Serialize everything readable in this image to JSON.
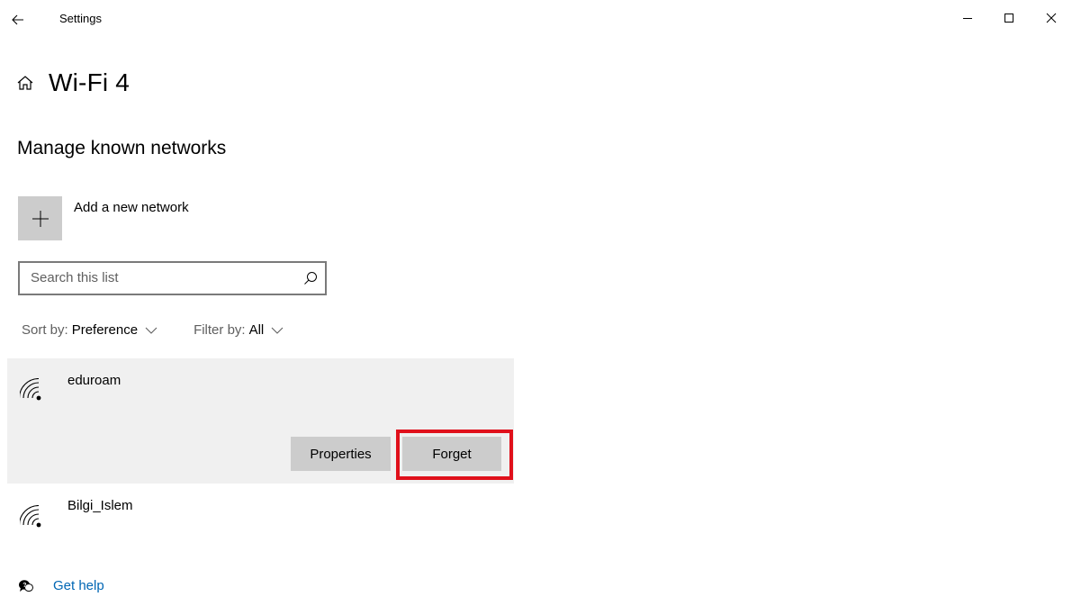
{
  "window": {
    "app_title": "Settings",
    "back_icon": "back-arrow-icon",
    "controls": [
      "minimize-icon",
      "maximize-icon",
      "close-icon"
    ]
  },
  "header": {
    "icon": "home-icon",
    "title": "Wi-Fi 4"
  },
  "section": {
    "title": "Manage known networks"
  },
  "add_network": {
    "icon": "plus-icon",
    "label": "Add a new network"
  },
  "search": {
    "placeholder": "Search this list",
    "value": "",
    "icon": "search-icon"
  },
  "sort": {
    "label": "Sort by:",
    "value": "Preference"
  },
  "filter": {
    "label": "Filter by:",
    "value": "All"
  },
  "networks": [
    {
      "name": "eduroam",
      "icon": "wifi-icon",
      "selected": true,
      "actions": {
        "properties": "Properties",
        "forget": "Forget"
      }
    },
    {
      "name": "Bilgi_Islem",
      "icon": "wifi-icon",
      "selected": false
    }
  ],
  "help": {
    "icon": "help-chat-icon",
    "label": "Get help"
  },
  "colors": {
    "selected_bg": "#f0f0f0",
    "button_bg": "#cccccc",
    "highlight_border": "#e0101b",
    "link": "#0066b4"
  }
}
